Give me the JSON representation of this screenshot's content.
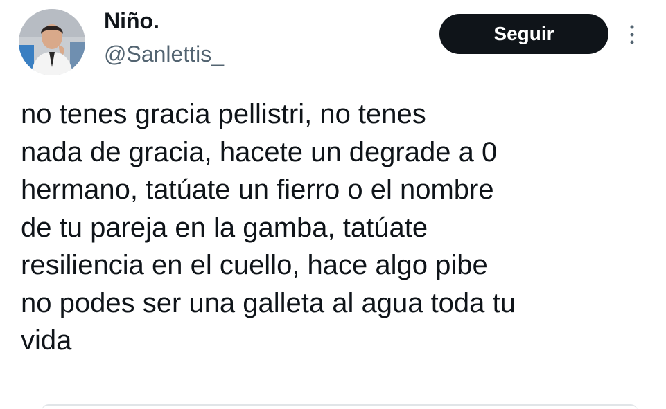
{
  "tweet": {
    "author": {
      "display_name": "Niño.",
      "handle": "@Sanlettis_",
      "avatar_icon": "user-avatar"
    },
    "follow_label": "Seguir",
    "more_icon": "more-vertical-icon",
    "text_lines": [
      "no tenes gracia pellistri, no tenes",
      "nada de gracia, hacete un degrade a 0",
      "hermano, tatúate un fierro o el nombre",
      "de tu pareja en la gamba, tatúate",
      "resiliencia en el cuello, hace algo pibe",
      "no podes ser una galleta al agua toda tu",
      "vida"
    ]
  },
  "colors": {
    "text": "#0f1419",
    "secondary_text": "#536471",
    "button_bg": "#0f1419",
    "button_text": "#ffffff",
    "background": "#ffffff"
  }
}
